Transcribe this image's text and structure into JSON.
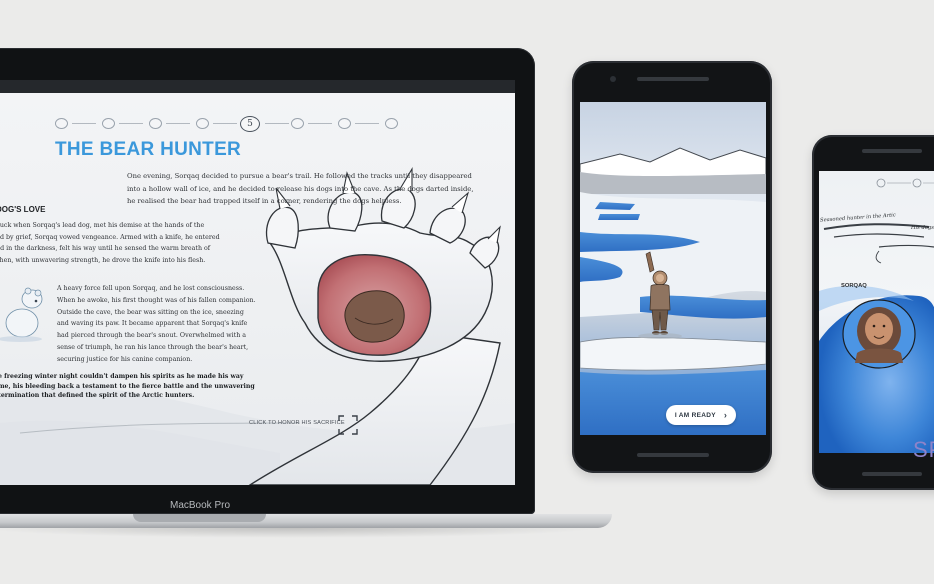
{
  "laptop": {
    "brand_label": "MacBook Pro",
    "progress": {
      "current_step": "5",
      "total_steps": 8
    },
    "story": {
      "title": "THE BEAR HUNTER",
      "intro": "One evening, Sorqaq decided to pursue a bear's trail. He followed the tracks until they disappeared into a hollow wall of ice, and he decided to release his dogs into the cave. As the dogs darted inside, he realised the bear had trapped itself in a corner, rendering the dogs helpless.",
      "section_heading": "DOG'S LOVE",
      "section_lines": [
        "agedy struck when Sorqaq's lead dog, met his demise at the hands of the",
        "ar. Fuelled by grief, Sorqaq vowed vengeance. Armed with a knife, he entered",
        "e cave and in the darkness, felt his way until he sensed the warm breath of",
        "e beast, then, with unwavering strength, he drove the knife into his flesh."
      ],
      "consciousness_paragraph": "A heavy force fell upon Sorqaq, and he lost consciousness. When he awoke, his first thought was of his fallen companion. Outside the cave, the bear was sitting on the ice, sneezing and waving its paw. It became apparent that Sorqaq's knife had pierced through the bear's snout. Overwhelmed with a sense of triumph, he ran his lance through the bear's heart, securing justice for his canine companion.",
      "closing_lines": [
        "e freezing winter night couldn't dampen his spirits as he made his way",
        "me, his bleeding back a testament to the fierce battle and the unwavering",
        "termination that defined the spirit of the Arctic hunters."
      ],
      "cta": "CLICK TO  HONOR HIS SACRIFICE"
    }
  },
  "phone_one": {
    "button_label": "I AM READY",
    "button_icon": "chevron-right-icon"
  },
  "phone_two": {
    "caption_one": "Seasoned hunter in the Artic",
    "caption_two": "His dogs",
    "name_label": "SORQAQ",
    "large_text": "SP"
  },
  "colors": {
    "title_blue": "#3b98db",
    "background": "#ebebea",
    "water_blue": "#3f86d6",
    "paw_pad": "#c06a6e",
    "big_text_purple": "#8e83c9"
  }
}
